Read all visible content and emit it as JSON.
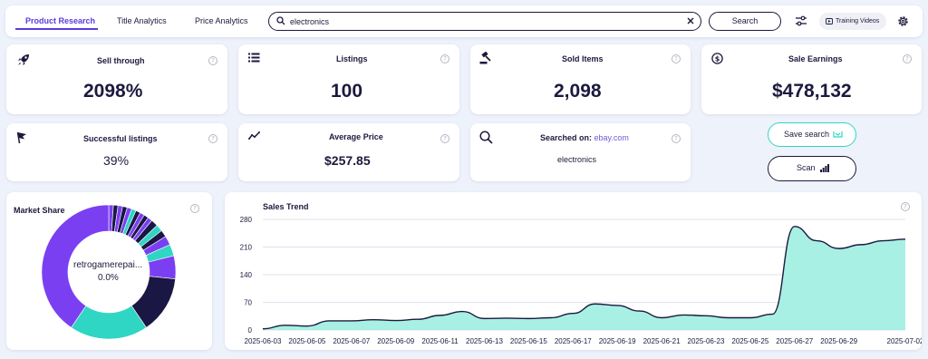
{
  "tabs": [
    {
      "label": "Product Research",
      "active": true
    },
    {
      "label": "Title Analytics",
      "active": false
    },
    {
      "label": "Price Analytics",
      "active": false
    }
  ],
  "search": {
    "value": "electronics",
    "button_label": "Search"
  },
  "toolbar": {
    "training_label": "Training Videos"
  },
  "stats": {
    "sell_through": {
      "title": "Sell through",
      "value": "2098%"
    },
    "listings": {
      "title": "Listings",
      "value": "100"
    },
    "sold_items": {
      "title": "Sold Items",
      "value": "2,098"
    },
    "sale_earnings": {
      "title": "Sale Earnings",
      "value": "$478,132"
    },
    "successful_listings": {
      "title": "Successful listings",
      "value": "39%"
    },
    "average_price": {
      "title": "Average Price",
      "value": "$257.85"
    },
    "searched_on": {
      "title": "Searched on:",
      "site": "ebay.com",
      "value": "electronics"
    }
  },
  "actions": {
    "save_label": "Save search",
    "scan_label": "Scan"
  },
  "market_share": {
    "title": "Market Share",
    "center_name": "retrogamerepai...",
    "center_value": "0.0%",
    "colors": [
      "#7b3ff2",
      "#2ed6c3",
      "#1a1745"
    ]
  },
  "chart_data": {
    "type": "area",
    "title": "Sales Trend",
    "xlabel": "",
    "ylabel": "",
    "y_ticks": [
      0,
      70,
      140,
      210,
      280
    ],
    "ylim": [
      0,
      280
    ],
    "x_tick_labels": [
      "2025-06-03",
      "2025-06-05",
      "2025-06-07",
      "2025-06-09",
      "2025-06-11",
      "2025-06-13",
      "2025-06-15",
      "2025-06-17",
      "2025-06-19",
      "2025-06-21",
      "2025-06-23",
      "2025-06-25",
      "2025-06-27",
      "2025-06-29",
      "2025-07-02"
    ],
    "grid": true,
    "fill_color": "#a8f0e4",
    "line_color": "#1b1a3d",
    "series": [
      {
        "x": [
          "2025-06-03",
          "2025-06-04",
          "2025-06-05",
          "2025-06-06",
          "2025-06-07",
          "2025-06-08",
          "2025-06-09",
          "2025-06-10",
          "2025-06-11",
          "2025-06-12",
          "2025-06-13",
          "2025-06-14",
          "2025-06-15",
          "2025-06-16",
          "2025-06-17",
          "2025-06-18",
          "2025-06-19",
          "2025-06-20",
          "2025-06-21",
          "2025-06-22",
          "2025-06-23",
          "2025-06-24",
          "2025-06-25",
          "2025-06-26",
          "2025-06-27",
          "2025-06-28",
          "2025-06-29",
          "2025-06-30",
          "2025-07-01",
          "2025-07-02"
        ],
        "values": [
          3,
          12,
          10,
          23,
          23,
          26,
          24,
          27,
          37,
          47,
          29,
          30,
          29,
          31,
          42,
          66,
          62,
          48,
          31,
          38,
          36,
          31,
          31,
          40,
          262,
          226,
          206,
          216,
          226,
          230
        ]
      }
    ]
  }
}
